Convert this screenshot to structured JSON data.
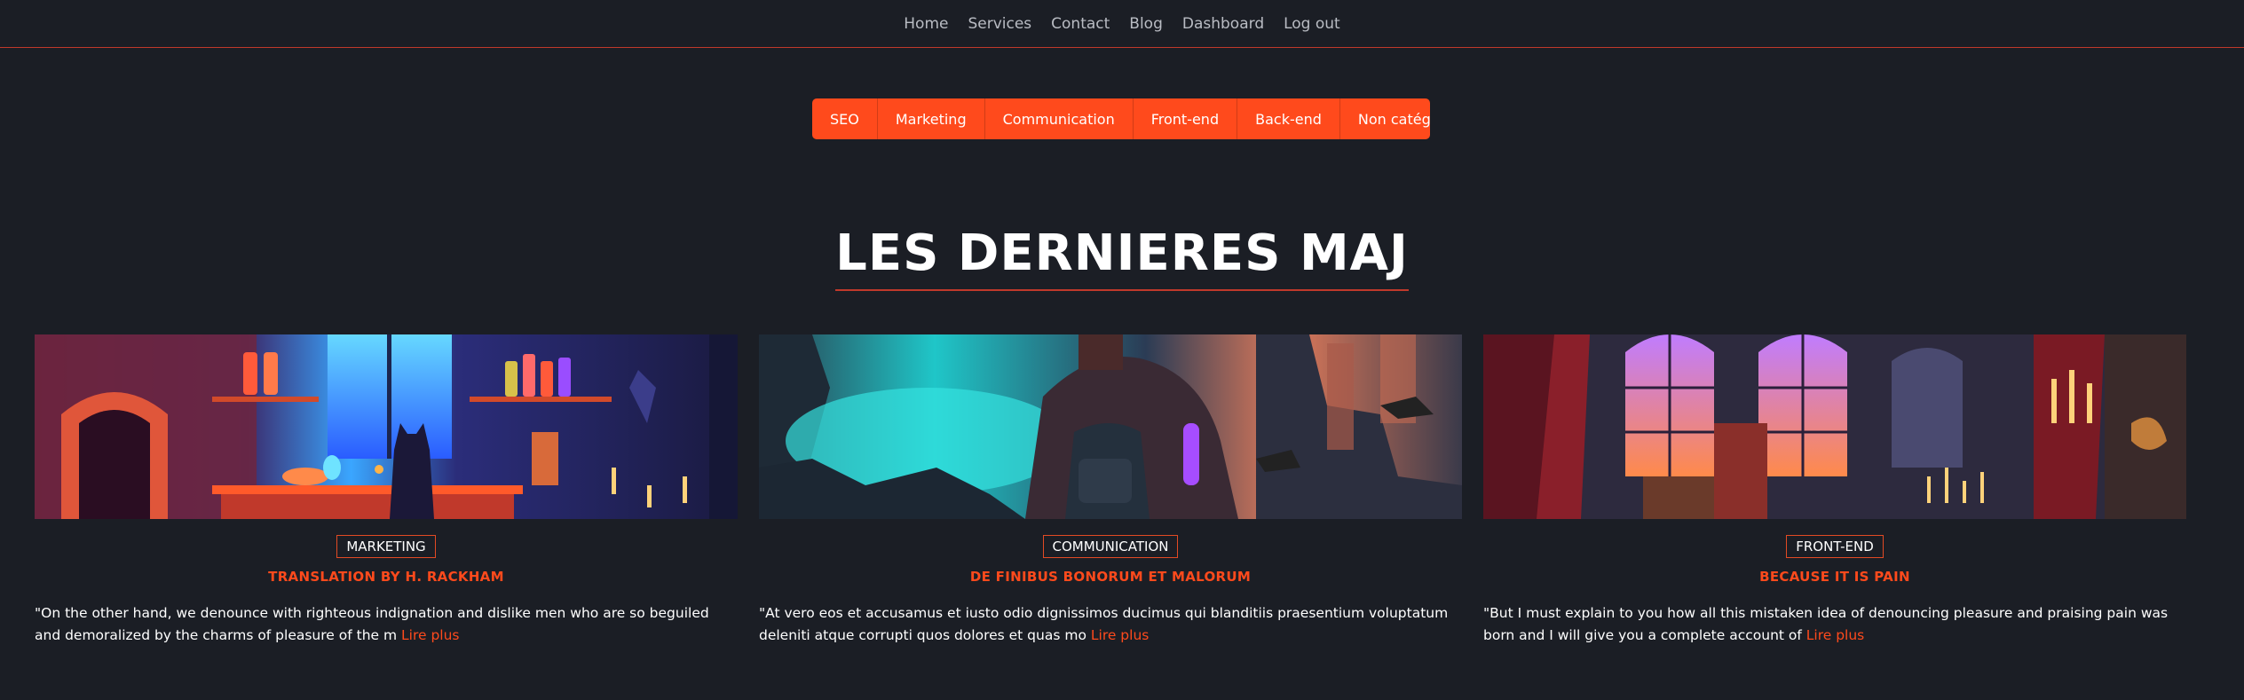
{
  "nav": {
    "items": [
      "Home",
      "Services",
      "Contact",
      "Blog",
      "Dashboard",
      "Log out"
    ]
  },
  "categories": [
    "SEO",
    "Marketing",
    "Communication",
    "Front-end",
    "Back-end",
    "Non catégorisé"
  ],
  "section": {
    "title": "LES DERNIERES MAJ"
  },
  "posts": [
    {
      "category": "MARKETING",
      "title": "TRANSLATION BY H. RACKHAM",
      "excerpt": "\"On the other hand, we denounce with righteous indignation and dislike men who are so beguiled and demoralized by the charms of pleasure of the m",
      "more": "Lire plus",
      "image": "witch-cat-potion-room-illustration"
    },
    {
      "category": "COMMUNICATION",
      "title": "DE FINIBUS BONORUM ET MALORUM",
      "excerpt": "\"At vero eos et accusamus et iusto odio dignissimos ducimus qui blanditiis praesentium voluptatum deleniti atque corrupti quos dolores et quas mo",
      "more": "Lire plus",
      "image": "hooded-traveler-ruined-city-illustration"
    },
    {
      "category": "FRONT-END",
      "title": "BECAUSE IT IS PAIN",
      "excerpt": "\"But I must explain to you how all this mistaken idea of denouncing pleasure and praising pain was born and I will give you a complete account of",
      "more": "Lire plus",
      "image": "gothic-cathedral-interior-illustration"
    }
  ],
  "colors": {
    "accent": "#ff4a1c",
    "background": "#1b1e25",
    "divider": "#c0392b"
  }
}
